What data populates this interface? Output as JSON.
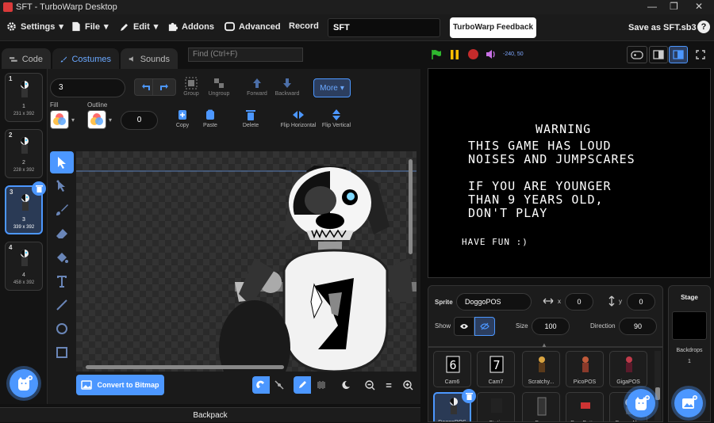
{
  "window": {
    "title": "SFT - TurboWarp Desktop"
  },
  "menu": {
    "settings": "Settings",
    "file": "File",
    "edit": "Edit",
    "addons": "Addons",
    "advanced": "Advanced",
    "record": "Record",
    "project_title": "SFT",
    "feedback": "TurboWarp Feedback",
    "save_as": "Save as SFT.sb3",
    "help": "?"
  },
  "tabs": {
    "code": "Code",
    "costumes": "Costumes",
    "sounds": "Sounds"
  },
  "find": {
    "placeholder": "Find (Ctrl+F)"
  },
  "costumes": [
    {
      "num": "1",
      "name": "1",
      "size": "231 x 392"
    },
    {
      "num": "2",
      "name": "2",
      "size": "228 x 392"
    },
    {
      "num": "3",
      "name": "3",
      "size": "339 x 392",
      "selected": true
    },
    {
      "num": "4",
      "name": "4",
      "size": "458 x 392"
    }
  ],
  "paint": {
    "costume_name": "3",
    "group": "Group",
    "ungroup": "Ungroup",
    "forward": "Forward",
    "backward": "Backward",
    "more": "More",
    "fill_label": "Fill",
    "outline_label": "Outline",
    "outline_width": "0",
    "copy": "Copy",
    "paste": "Paste",
    "delete": "Delete",
    "flip_h": "Flip Horizontal",
    "flip_v": "Flip Vertical",
    "convert": "Convert to Bitmap",
    "zoom_reset": "="
  },
  "backpack": "Backpack",
  "stage_controls": {
    "coords": "-240, 50"
  },
  "stage_text": {
    "l1": "WARNING",
    "l2": "THIS GAME HAS LOUD",
    "l3": "NOISES AND JUMPSCARES",
    "l4": "IF YOU ARE YOUNGER",
    "l5": "THAN 9 YEARS OLD,",
    "l6": "DON'T PLAY",
    "l7": "HAVE FUN :)"
  },
  "sprite_info": {
    "sprite_label": "Sprite",
    "sprite_name": "DoggoPOS",
    "x_label": "x",
    "x": "0",
    "y_label": "y",
    "y": "0",
    "show_label": "Show",
    "size_label": "Size",
    "size": "100",
    "direction_label": "Direction",
    "direction": "90"
  },
  "sprites": [
    {
      "name": "Cam6"
    },
    {
      "name": "Cam7"
    },
    {
      "name": "Scratchy..."
    },
    {
      "name": "PicoPOS"
    },
    {
      "name": "GigaPOS"
    },
    {
      "name": "DoggoPOS"
    },
    {
      "name": "Static"
    },
    {
      "name": "Door"
    },
    {
      "name": "DoorButton"
    },
    {
      "name": "DoggoAl..."
    }
  ],
  "stage_panel": {
    "title": "Stage",
    "backdrops_label": "Backdrops",
    "backdrops_count": "1"
  },
  "colors": {
    "accent": "#4c97ff",
    "flag": "#2fb82f",
    "pause": "#ffbf00",
    "stop": "#c42b2b"
  }
}
